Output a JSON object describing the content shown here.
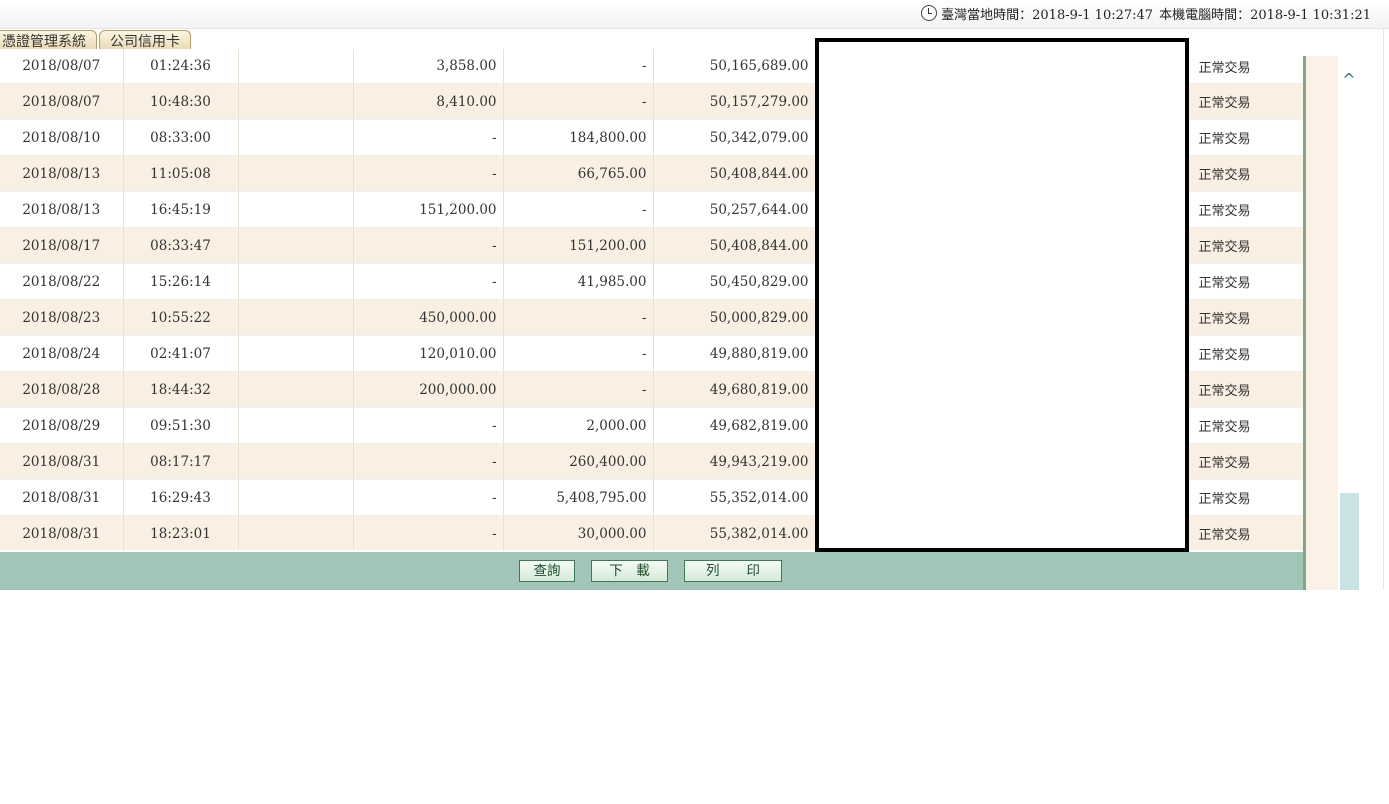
{
  "header": {
    "taiwan_time": "臺灣當地時間：2018-9-1 10:27:47",
    "local_time": "本機電腦時間：2018-9-1 10:31:21"
  },
  "tabs": [
    "憑證管理系統",
    "公司信用卡"
  ],
  "rows": [
    {
      "date": "2018/08/07",
      "time": "01:24:36",
      "withdraw": "3,858.00",
      "deposit": "-",
      "balance": "50,165,689.00",
      "status": "正常交易"
    },
    {
      "date": "2018/08/07",
      "time": "10:48:30",
      "withdraw": "8,410.00",
      "deposit": "-",
      "balance": "50,157,279.00",
      "status": "正常交易"
    },
    {
      "date": "2018/08/10",
      "time": "08:33:00",
      "withdraw": "-",
      "deposit": "184,800.00",
      "balance": "50,342,079.00",
      "status": "正常交易"
    },
    {
      "date": "2018/08/13",
      "time": "11:05:08",
      "withdraw": "-",
      "deposit": "66,765.00",
      "balance": "50,408,844.00",
      "status": "正常交易"
    },
    {
      "date": "2018/08/13",
      "time": "16:45:19",
      "withdraw": "151,200.00",
      "deposit": "-",
      "balance": "50,257,644.00",
      "status": "正常交易"
    },
    {
      "date": "2018/08/17",
      "time": "08:33:47",
      "withdraw": "-",
      "deposit": "151,200.00",
      "balance": "50,408,844.00",
      "status": "正常交易"
    },
    {
      "date": "2018/08/22",
      "time": "15:26:14",
      "withdraw": "-",
      "deposit": "41,985.00",
      "balance": "50,450,829.00",
      "status": "正常交易"
    },
    {
      "date": "2018/08/23",
      "time": "10:55:22",
      "withdraw": "450,000.00",
      "deposit": "-",
      "balance": "50,000,829.00",
      "status": "正常交易"
    },
    {
      "date": "2018/08/24",
      "time": "02:41:07",
      "withdraw": "120,010.00",
      "deposit": "-",
      "balance": "49,880,819.00",
      "status": "正常交易"
    },
    {
      "date": "2018/08/28",
      "time": "18:44:32",
      "withdraw": "200,000.00",
      "deposit": "-",
      "balance": "49,680,819.00",
      "status": "正常交易"
    },
    {
      "date": "2018/08/29",
      "time": "09:51:30",
      "withdraw": "-",
      "deposit": "2,000.00",
      "balance": "49,682,819.00",
      "status": "正常交易"
    },
    {
      "date": "2018/08/31",
      "time": "08:17:17",
      "withdraw": "-",
      "deposit": "260,400.00",
      "balance": "49,943,219.00",
      "status": "正常交易"
    },
    {
      "date": "2018/08/31",
      "time": "16:29:43",
      "withdraw": "-",
      "deposit": "5,408,795.00",
      "balance": "55,352,014.00",
      "status": "正常交易"
    },
    {
      "date": "2018/08/31",
      "time": "18:23:01",
      "withdraw": "-",
      "deposit": "30,000.00",
      "balance": "55,382,014.00",
      "status": "正常交易"
    }
  ],
  "buttons": {
    "query": "查詢",
    "download": "下　載",
    "print": "列　　印"
  },
  "icons": {
    "clock": "clock-icon",
    "scroll_up": "chevron-up-icon"
  }
}
